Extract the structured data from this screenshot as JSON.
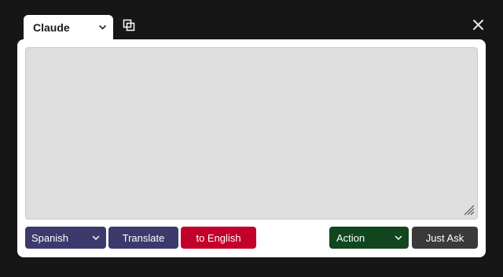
{
  "tab": {
    "label": "Claude",
    "icon": "chevron-down-icon"
  },
  "header": {
    "copy_icon": "copy-window-icon",
    "close_icon": "close-icon"
  },
  "editor": {
    "value": "",
    "placeholder": ""
  },
  "controls": {
    "language_selected": "Spanish",
    "translate_label": "Translate",
    "to_english_label": "to English",
    "action_selected": "Action",
    "just_ask_label": "Just Ask"
  },
  "colors": {
    "background": "#161616",
    "panel": "#ffffff",
    "textarea": "#dedede",
    "language_button": "#3c3a6c",
    "to_english_button": "#c2002a",
    "action_button": "#12461f",
    "just_ask_button": "#3a3a3a"
  }
}
